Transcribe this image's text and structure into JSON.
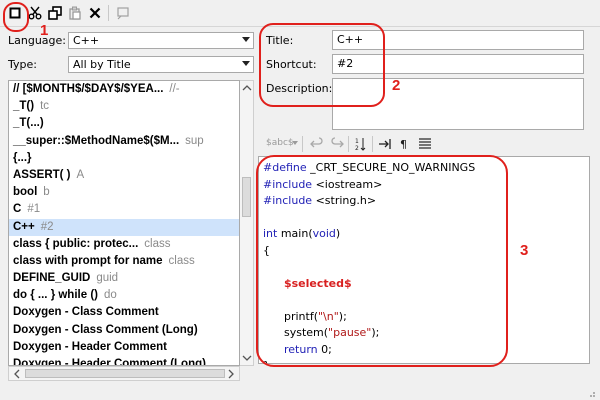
{
  "toolbar": {
    "buttons": [
      "new-icon",
      "cut-icon",
      "copy-icon",
      "paste-icon",
      "delete-icon",
      "filter-icon"
    ]
  },
  "annotations": {
    "one": "1",
    "two": "2",
    "three": "3"
  },
  "left": {
    "language_label": "Language:",
    "language_value": "C++",
    "type_label": "Type:",
    "type_value": "All by Title",
    "items": [
      {
        "name": "//   [$MONTH$/$DAY$/$YEA...",
        "abbr": "//-"
      },
      {
        "name": "_T()",
        "abbr": "tc"
      },
      {
        "name": "_T(...)",
        "abbr": ""
      },
      {
        "name": "__super::$MethodName$($M...",
        "abbr": "sup"
      },
      {
        "name": "{...}",
        "abbr": ""
      },
      {
        "name": "ASSERT( )",
        "abbr": "A"
      },
      {
        "name": "bool",
        "abbr": "b"
      },
      {
        "name": "C",
        "abbr": "#1"
      },
      {
        "name": "C++",
        "abbr": "#2"
      },
      {
        "name": "class   { public: protec...",
        "abbr": "class"
      },
      {
        "name": "class with prompt for name",
        "abbr": "class"
      },
      {
        "name": "DEFINE_GUID",
        "abbr": "guid"
      },
      {
        "name": "do { ... } while ()",
        "abbr": "do"
      },
      {
        "name": "Doxygen - Class Comment",
        "abbr": ""
      },
      {
        "name": "Doxygen - Class Comment (Long)",
        "abbr": ""
      },
      {
        "name": "Doxygen - Header Comment",
        "abbr": ""
      },
      {
        "name": "Doxygen - Header Comment (Long)",
        "abbr": ""
      }
    ],
    "selected_index": 8
  },
  "right": {
    "title_label": "Title:",
    "title_value": "C++",
    "shortcut_label": "Shortcut:",
    "shortcut_value": "#2",
    "description_label": "Description:",
    "description_value": "",
    "editor_toolbar_text": "$abc$",
    "code_lines": [
      [
        {
          "t": "#define",
          "c": "kw"
        },
        {
          "t": " _CRT_SECURE_NO_WARNINGS",
          "c": ""
        }
      ],
      [
        {
          "t": "#include",
          "c": "kw"
        },
        {
          "t": " <iostream>",
          "c": ""
        }
      ],
      [
        {
          "t": "#include",
          "c": "kw"
        },
        {
          "t": " <string.h>",
          "c": ""
        }
      ],
      [],
      [
        {
          "t": "int",
          "c": "kw"
        },
        {
          "t": " main(",
          "c": ""
        },
        {
          "t": "void",
          "c": "kw"
        },
        {
          "t": ")",
          "c": ""
        }
      ],
      [
        {
          "t": "{",
          "c": ""
        }
      ],
      [],
      [
        {
          "t": "      ",
          "c": ""
        },
        {
          "t": "$selected$",
          "c": "sel-var"
        }
      ],
      [],
      [
        {
          "t": "      printf(",
          "c": ""
        },
        {
          "t": "\"\\n\"",
          "c": "str"
        },
        {
          "t": ");",
          "c": ""
        }
      ],
      [
        {
          "t": "      system(",
          "c": ""
        },
        {
          "t": "\"pause\"",
          "c": "str"
        },
        {
          "t": ");",
          "c": ""
        }
      ],
      [
        {
          "t": "      ",
          "c": ""
        },
        {
          "t": "return",
          "c": "kw"
        },
        {
          "t": " 0;",
          "c": ""
        }
      ],
      [
        {
          "t": "}",
          "c": ""
        }
      ]
    ]
  },
  "colors": {
    "annotation_red": "#e0201c",
    "selection_blue": "#cfe3fb",
    "keyword_blue": "#1f1fb5",
    "string_red": "#b01818"
  }
}
